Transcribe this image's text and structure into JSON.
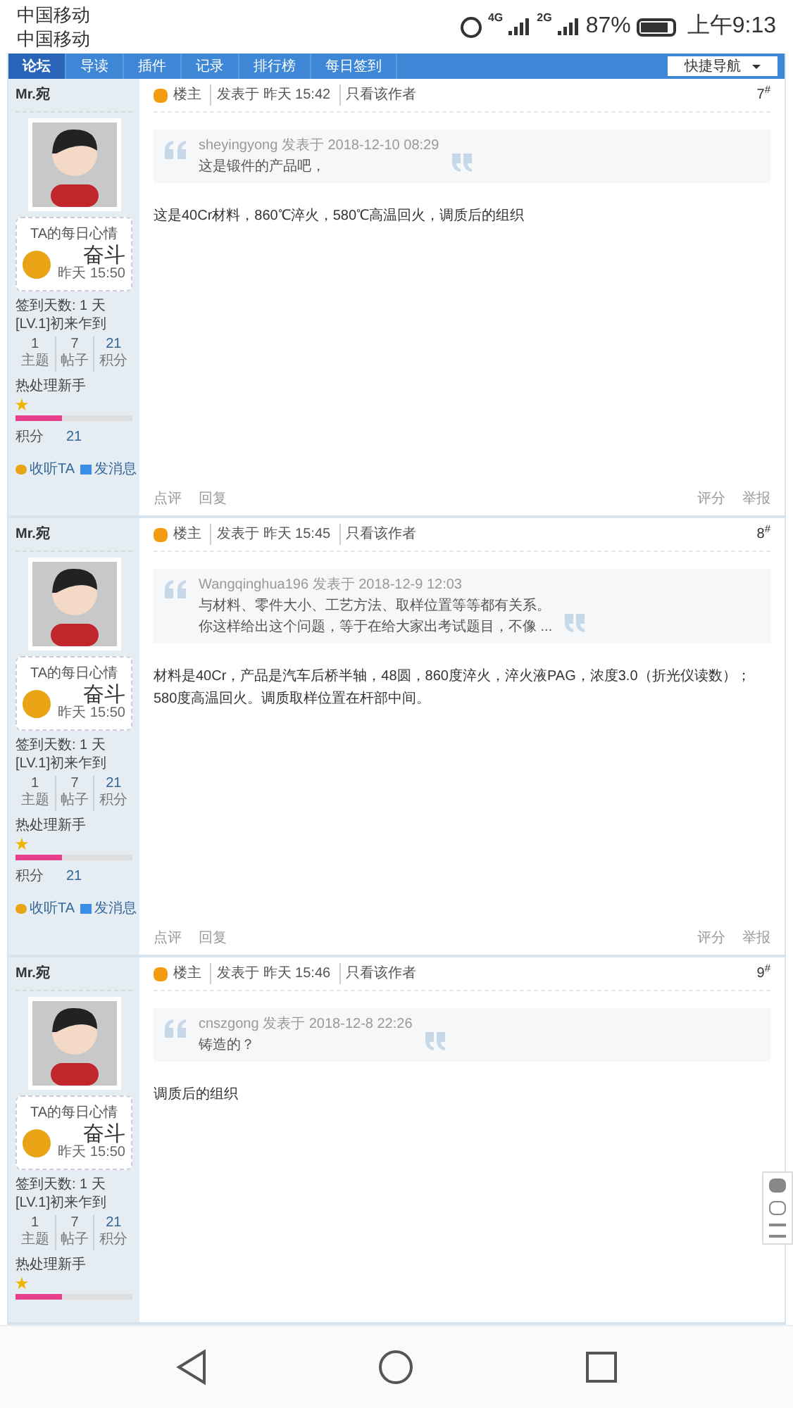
{
  "status_bar": {
    "carriers": [
      "中国移动",
      "中国移动"
    ],
    "network_1": "4G",
    "network_2": "2G",
    "battery": "87%",
    "time": "上午9:13"
  },
  "nav": {
    "tabs": [
      {
        "label": "论坛",
        "selected": true
      },
      {
        "label": "导读",
        "selected": false
      },
      {
        "label": "插件",
        "selected": false
      },
      {
        "label": "记录",
        "selected": false
      },
      {
        "label": "排行榜",
        "selected": false
      },
      {
        "label": "每日签到",
        "selected": false
      }
    ],
    "quick_nav": "快捷导航"
  },
  "posts": [
    {
      "author": "Mr.宛",
      "mood_title": "TA的每日心情",
      "mood": "奋斗",
      "mood_time": "昨天 15:50",
      "sign_days": "签到天数: 1 天",
      "rank": "[LV.1]初来乍到",
      "stats": [
        {
          "value": "1",
          "label": "主题"
        },
        {
          "value": "7",
          "label": "帖子"
        },
        {
          "value": "21",
          "label": "积分"
        }
      ],
      "group": "热处理新手",
      "level": 0.4,
      "points_label": "积分",
      "points": "21",
      "actions": [
        "收听TA",
        "发消息"
      ],
      "op_label": "楼主",
      "posted": "发表于 昨天 15:42",
      "author_only": "只看该作者",
      "floor": "7",
      "floor_mark": "#",
      "quote_head": "sheyingyong 发表于 2018-12-10 08:29",
      "quote_lines": [
        "这是锻件的产品吧，"
      ],
      "body": "这是40Cr材料，860℃淬火，580℃高温回火，调质后的组织",
      "footer_left": [
        "点评",
        "回复"
      ],
      "footer_right": [
        "评分",
        "举报"
      ]
    },
    {
      "author": "Mr.宛",
      "mood_title": "TA的每日心情",
      "mood": "奋斗",
      "mood_time": "昨天 15:50",
      "sign_days": "签到天数: 1 天",
      "rank": "[LV.1]初来乍到",
      "stats": [
        {
          "value": "1",
          "label": "主题"
        },
        {
          "value": "7",
          "label": "帖子"
        },
        {
          "value": "21",
          "label": "积分"
        }
      ],
      "group": "热处理新手",
      "level": 0.4,
      "points_label": "积分",
      "points": "21",
      "actions": [
        "收听TA",
        "发消息"
      ],
      "op_label": "楼主",
      "posted": "发表于 昨天 15:45",
      "author_only": "只看该作者",
      "floor": "8",
      "floor_mark": "#",
      "quote_head": "Wangqinghua196 发表于 2018-12-9 12:03",
      "quote_lines": [
        "与材料、零件大小、工艺方法、取样位置等等都有关系。",
        "你这样给出这个问题，等于在给大家出考试题目，不像 ..."
      ],
      "body": "材料是40Cr，产品是汽车后桥半轴，48圆，860度淬火，淬火液PAG，浓度3.0（折光仪读数）；580度高温回火。调质取样位置在杆部中间。",
      "footer_left": [
        "点评",
        "回复"
      ],
      "footer_right": [
        "评分",
        "举报"
      ]
    },
    {
      "author": "Mr.宛",
      "mood_title": "TA的每日心情",
      "mood": "奋斗",
      "mood_time": "昨天 15:50",
      "sign_days": "签到天数: 1 天",
      "rank": "[LV.1]初来乍到",
      "stats": [
        {
          "value": "1",
          "label": "主题"
        },
        {
          "value": "7",
          "label": "帖子"
        },
        {
          "value": "21",
          "label": "积分"
        }
      ],
      "group": "热处理新手",
      "level": 0.4,
      "op_label": "楼主",
      "posted": "发表于 昨天 15:46",
      "author_only": "只看该作者",
      "floor": "9",
      "floor_mark": "#",
      "quote_head": "cnszgong 发表于 2018-12-8 22:26",
      "quote_lines": [
        "铸造的？"
      ],
      "body": "调质后的组织"
    }
  ]
}
